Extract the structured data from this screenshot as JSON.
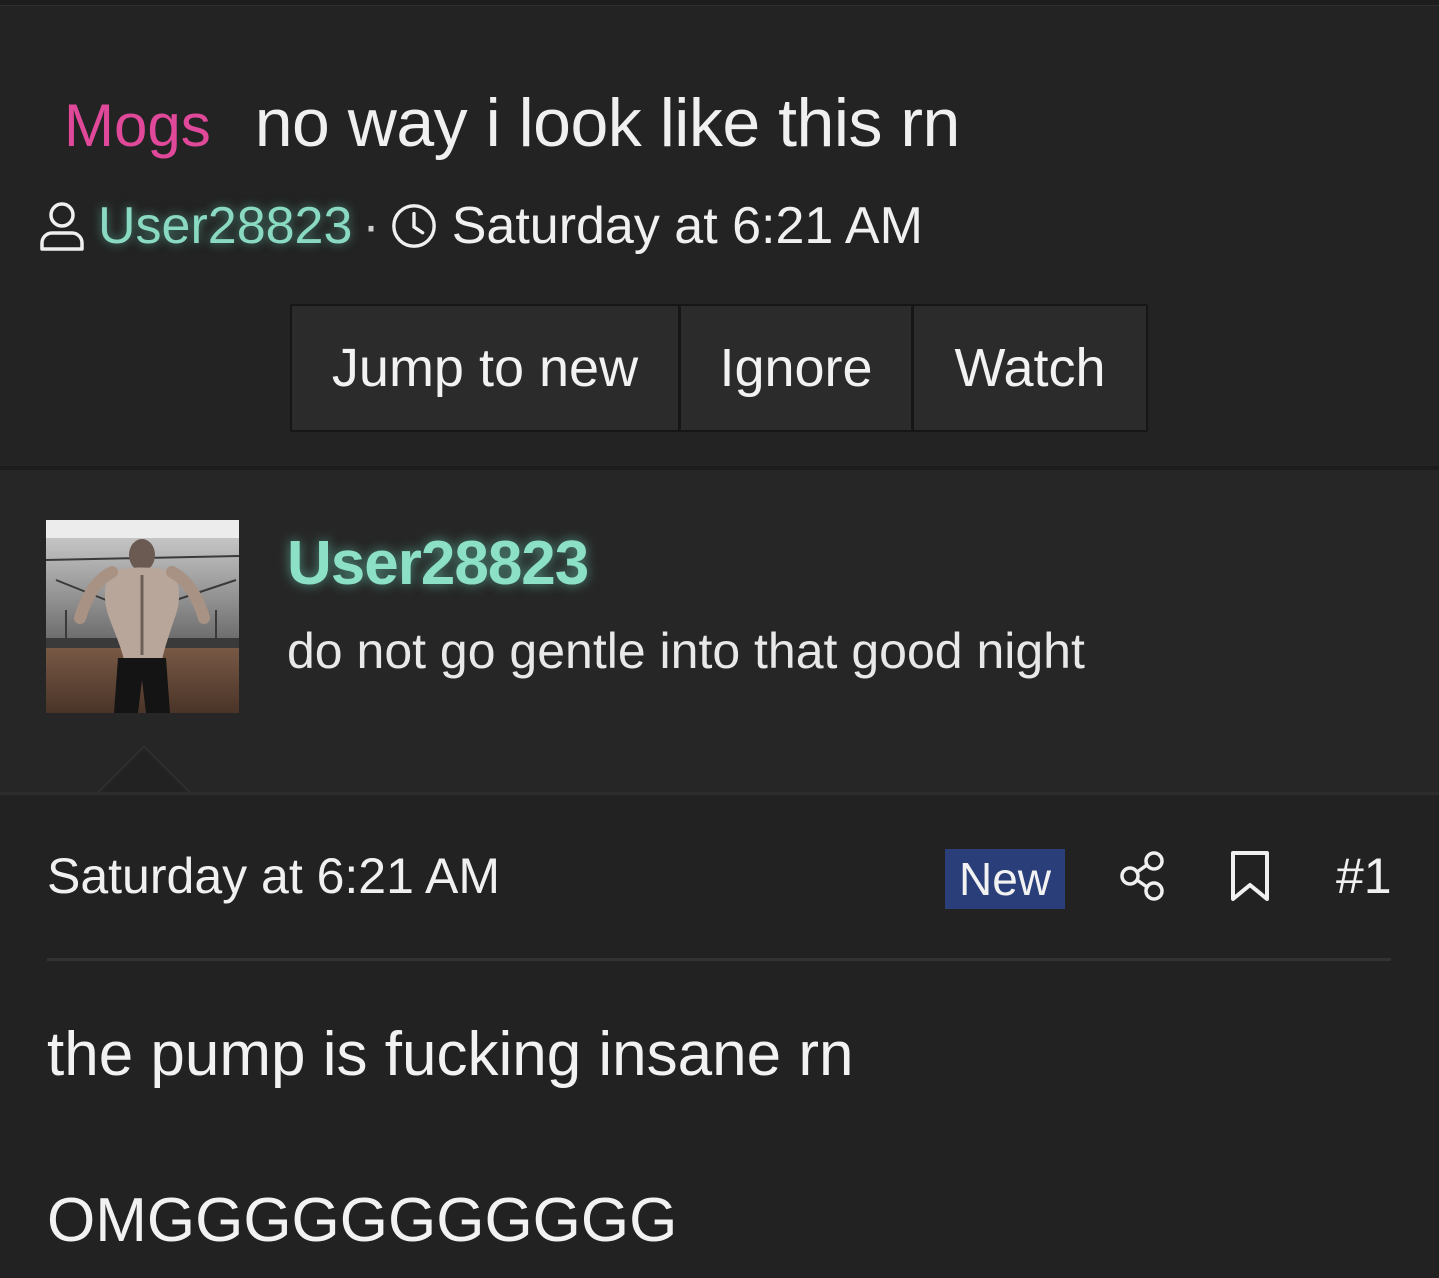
{
  "thread": {
    "prefix": "Mogs",
    "title": "no way i look like this rn",
    "starter": "User28823",
    "separator": "·",
    "started_time": "Saturday at 6:21 AM"
  },
  "actions": {
    "jump_to_new": "Jump to new",
    "ignore": "Ignore",
    "watch": "Watch"
  },
  "author": {
    "name": "User28823",
    "signature": "do not go gentle into that good night"
  },
  "post": {
    "time": "Saturday at 6:21 AM",
    "badge": "New",
    "number": "#1",
    "body_line1": "the pump is fucking insane rn",
    "body_line2": "OMGGGGGGGGGGG"
  },
  "icons": {
    "meta_user": "user-icon",
    "meta_time": "clock-icon",
    "share": "share-icon",
    "bookmark": "bookmark-icon"
  },
  "colors": {
    "background": "#232323",
    "prefix": "#e0489a",
    "username": "#8be0c6",
    "badge": "#2a3f7a"
  }
}
